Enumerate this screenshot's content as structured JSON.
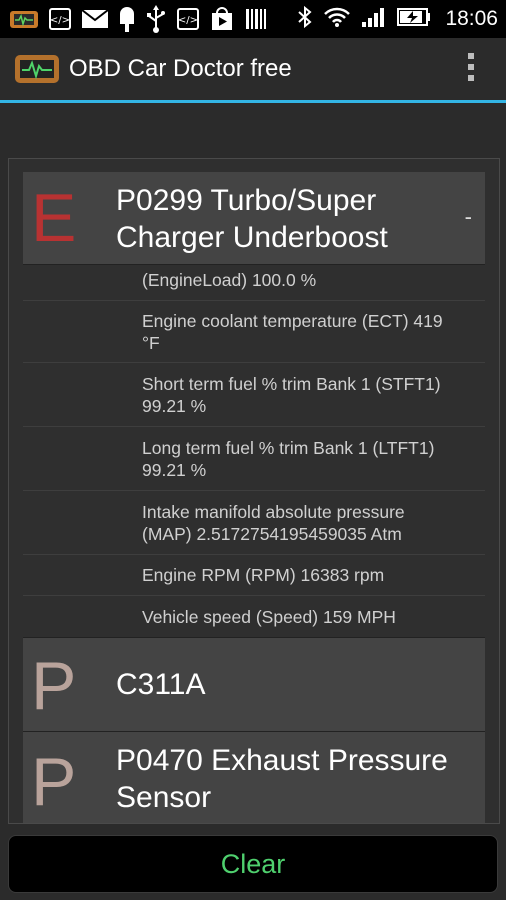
{
  "status_bar": {
    "icons": [
      "obd-app-icon",
      "code-icon",
      "mail-icon",
      "popsicle-icon",
      "usb-icon",
      "code-icon",
      "play-store-icon",
      "barcode-icon",
      "bluetooth-icon",
      "wifi-icon",
      "signal-icon",
      "battery-charging-icon"
    ],
    "time": "18:06"
  },
  "action_bar": {
    "title": "OBD Car Doctor free",
    "accent_color": "#33b5e5"
  },
  "codes": [
    {
      "letter": "E",
      "letter_color": "#b83232",
      "title_line1": "P0299 Turbo/Super",
      "title_line2": "Charger Underboost",
      "toggle": "-"
    },
    {
      "letter": "P",
      "letter_color": "#b9a39b",
      "title_line1": "C311A",
      "title_line2": ""
    },
    {
      "letter": "P",
      "letter_color": "#b9a39b",
      "title_line1": "P0470 Exhaust Pressure",
      "title_line2": "Sensor"
    }
  ],
  "details": [
    {
      "line1": "(EngineLoad) 100.0 %",
      "line2": ""
    },
    {
      "line1": "Engine coolant temperature (ECT) 419",
      "line2": "°F"
    },
    {
      "line1": "Short term fuel % trim Bank 1 (STFT1)",
      "line2": "99.21 %"
    },
    {
      "line1": "Long term fuel % trim Bank 1 (LTFT1)",
      "line2": "99.21 %"
    },
    {
      "line1": "Intake manifold absolute pressure",
      "line2": "(MAP) 2.5172754195459035 Atm"
    },
    {
      "line1": "Engine RPM (RPM) 16383 rpm",
      "line2": ""
    },
    {
      "line1": "Vehicle speed (Speed) 159 MPH",
      "line2": ""
    }
  ],
  "clear_button": {
    "label": "Clear",
    "color": "#4fd06e"
  }
}
